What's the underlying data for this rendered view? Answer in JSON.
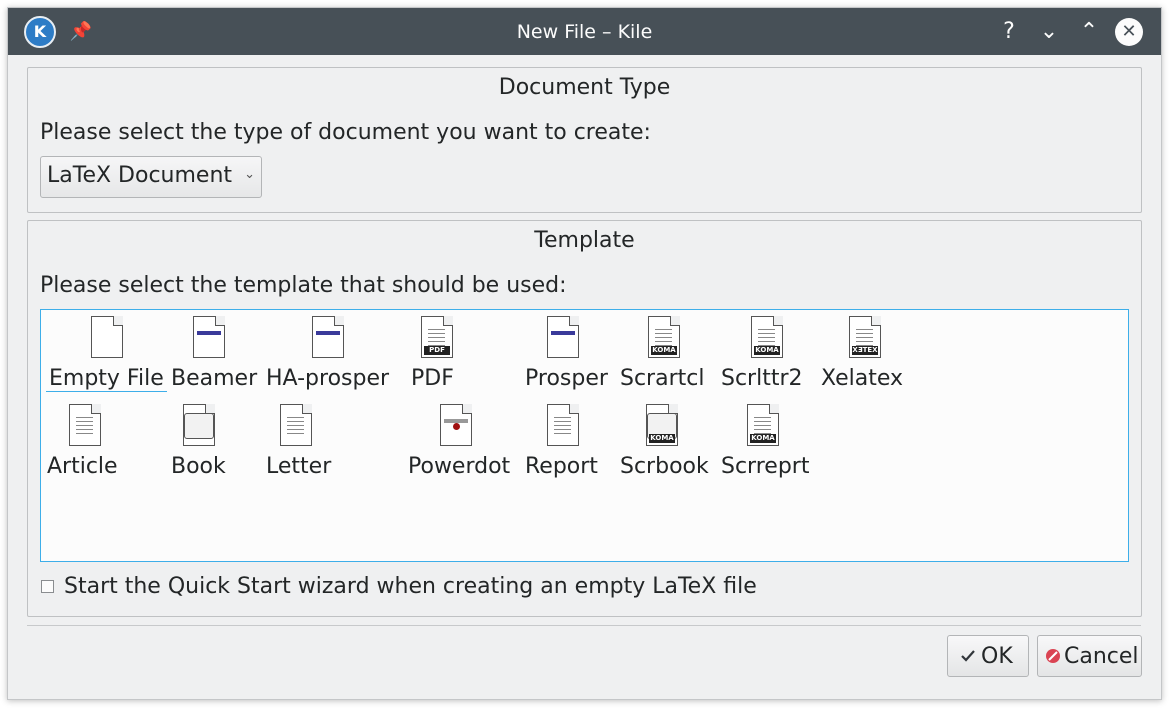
{
  "window": {
    "title": "New File – Kile",
    "app_icon_letter": "K",
    "controls": {
      "help": "?",
      "minimize": "⌄",
      "maximize": "⌃",
      "close": "✕"
    }
  },
  "document_type": {
    "title": "Document Type",
    "prompt": "Please select the type of document you want to create:",
    "selected": "LaTeX Document"
  },
  "template": {
    "title": "Template",
    "prompt": "Please select the template that should be used:",
    "items": [
      {
        "name": "Empty File",
        "icon": "blank-document-icon",
        "selected": true
      },
      {
        "name": "Beamer",
        "icon": "beamer-slide-icon"
      },
      {
        "name": "HA-prosper",
        "icon": "ha-prosper-slide-icon"
      },
      {
        "name": "PDF",
        "icon": "pdf-document-icon",
        "badge": "PDF"
      },
      {
        "name": "Prosper",
        "icon": "prosper-slide-icon"
      },
      {
        "name": "Scrartcl",
        "icon": "koma-article-icon",
        "badge": "KOMA"
      },
      {
        "name": "Scrlttr2",
        "icon": "koma-letter-icon",
        "badge": "KOMA"
      },
      {
        "name": "Xelatex",
        "icon": "xelatex-document-icon",
        "badge": "XƎTEX"
      },
      {
        "name": "Article",
        "icon": "article-document-icon"
      },
      {
        "name": "Book",
        "icon": "book-icon"
      },
      {
        "name": "Letter",
        "icon": "letter-document-icon"
      },
      {
        "name": "Powerdot",
        "icon": "powerdot-slide-icon"
      },
      {
        "name": "Report",
        "icon": "report-document-icon"
      },
      {
        "name": "Scrbook",
        "icon": "koma-book-icon",
        "badge": "KOMA"
      },
      {
        "name": "Scrreprt",
        "icon": "koma-report-icon",
        "badge": "KOMA"
      }
    ]
  },
  "quick_start": {
    "label": "Start the Quick Start wizard when creating an empty LaTeX file",
    "checked": false
  },
  "buttons": {
    "ok": "OK",
    "cancel": "Cancel"
  },
  "colors": {
    "titlebar": "#475057",
    "accent": "#3daee9",
    "window_bg": "#eff0f1"
  }
}
